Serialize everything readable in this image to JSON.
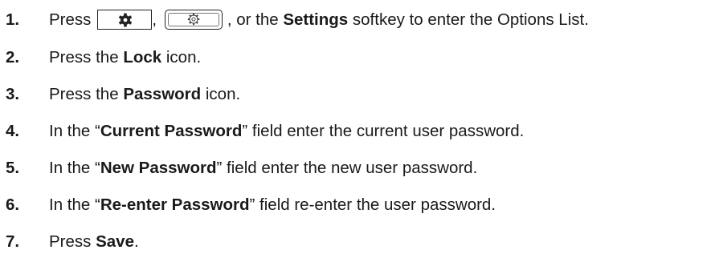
{
  "steps": [
    {
      "number": "1.",
      "t1": "Press",
      "t2": ",",
      "t3": ", or the",
      "bold": "Settings",
      "t4": "softkey to enter the Options List."
    },
    {
      "number": "2.",
      "pre": "Press the",
      "bold": "Lock",
      "post": "icon."
    },
    {
      "number": "3.",
      "pre": "Press the",
      "bold": "Password",
      "post": "icon."
    },
    {
      "number": "4.",
      "pre": "In the “",
      "bold": "Current Password",
      "post": "” field enter the current user password."
    },
    {
      "number": "5.",
      "pre": "In the “",
      "bold": "New Password",
      "post": "” field enter the new user password."
    },
    {
      "number": "6.",
      "pre": "In the “",
      "bold": "Re-enter Password",
      "post": "” field re-enter the user password."
    },
    {
      "number": "7.",
      "pre": "Press",
      "bold": "Save",
      "post": "."
    }
  ],
  "icons": {
    "settings_key": "gear-icon",
    "options_key": "gear-outline-icon"
  }
}
